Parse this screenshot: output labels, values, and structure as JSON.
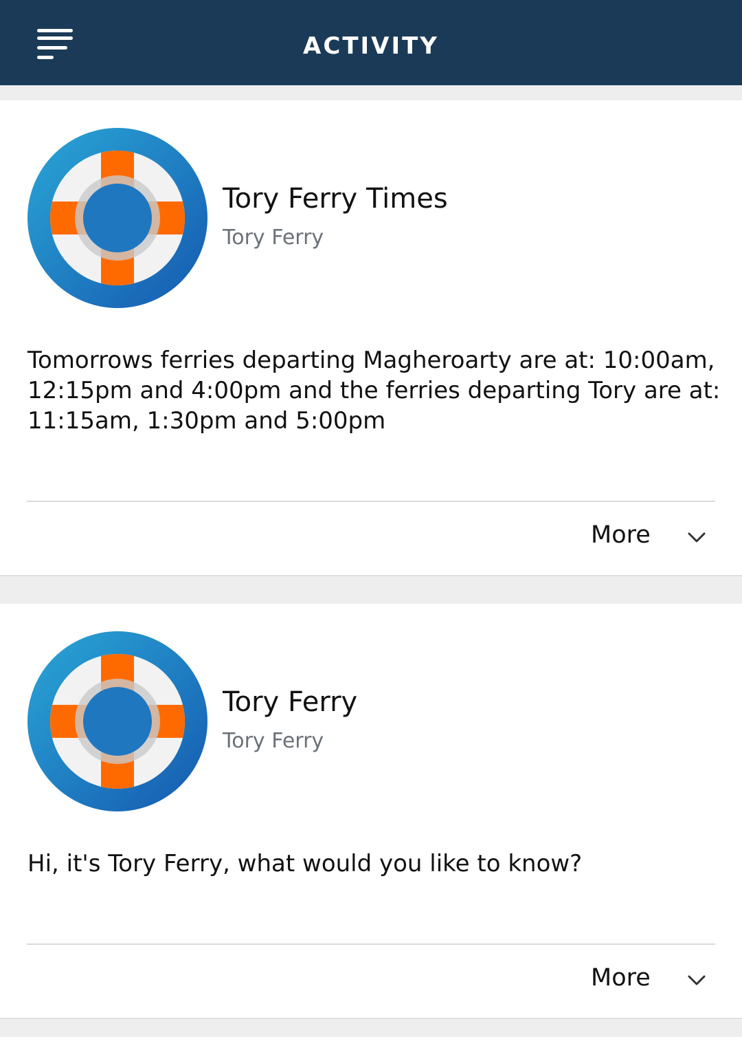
{
  "header": {
    "title": "ACTIVITY",
    "menu_icon": "hamburger-menu-icon",
    "background": "#1b3a57"
  },
  "cards": [
    {
      "avatar_icon": "lifebuoy-icon",
      "title": "Tory Ferry Times",
      "subtitle": "Tory Ferry",
      "body": "Tomorrows ferries departing Magheroarty are at: 10:00am, 12:15pm and 4:00pm and the ferries departing Tory are at: 11:15am, 1:30pm and 5:00pm",
      "more_label": "More"
    },
    {
      "avatar_icon": "lifebuoy-icon",
      "title": "Tory Ferry",
      "subtitle": "Tory Ferry",
      "body": "Hi, it's Tory Ferry, what would you like to know?",
      "more_label": "More"
    }
  ],
  "colors": {
    "avatar_ring": "#1f77c0",
    "lifebuoy_stripe": "#ff6a00",
    "lifebuoy_white": "#f2f2f2"
  }
}
